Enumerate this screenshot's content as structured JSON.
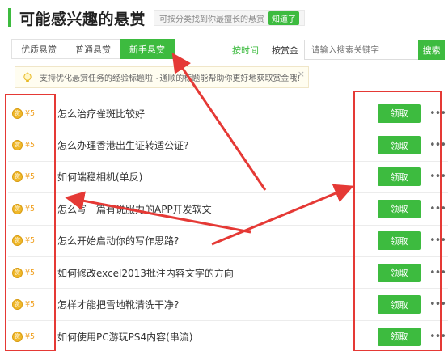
{
  "header": {
    "title": "可能感兴趣的悬赏",
    "tip": "可按分类找到你最擅长的悬赏",
    "tip_button": "知道了"
  },
  "tabs": [
    {
      "label": "优质悬赏",
      "active": false
    },
    {
      "label": "普通悬赏",
      "active": false
    },
    {
      "label": "新手悬赏",
      "active": true
    }
  ],
  "sort": {
    "by_time": "按时间",
    "by_reward": "按赏金"
  },
  "search": {
    "placeholder": "请输入搜索关键字",
    "button": "搜索"
  },
  "notice": {
    "text": "支持优化悬赏任务的经验标题啦~通顺的标题能帮助你更好地获取赏金哦!",
    "close": "×"
  },
  "items": [
    {
      "coin": "赏",
      "amount": "¥5",
      "question": "怎么治疗雀斑比较好",
      "action": "领取",
      "more": "•••"
    },
    {
      "coin": "赏",
      "amount": "¥5",
      "question": "怎么办理香港出生证转适公证?",
      "action": "领取",
      "more": "•••"
    },
    {
      "coin": "赏",
      "amount": "¥5",
      "question": "如何端稳相机(单反)",
      "action": "领取",
      "more": "•••"
    },
    {
      "coin": "赏",
      "amount": "¥5",
      "question": "怎么写一篇有说服力的APP开发软文",
      "action": "领取",
      "more": "•••"
    },
    {
      "coin": "赏",
      "amount": "¥5",
      "question": "怎么开始启动你的写作思路?",
      "action": "领取",
      "more": "•••"
    },
    {
      "coin": "赏",
      "amount": "¥5",
      "question": "如何修改excel2013批注内容文字的方向",
      "action": "领取",
      "more": "•••"
    },
    {
      "coin": "赏",
      "amount": "¥5",
      "question": "怎样才能把雪地靴清洗干净?",
      "action": "领取",
      "more": "•••"
    },
    {
      "coin": "赏",
      "amount": "¥5",
      "question": "如何使用PC游玩PS4内容(串流)",
      "action": "领取",
      "more": "•••"
    }
  ],
  "colors": {
    "accent": "#3dbb3f",
    "annotation": "#e53935",
    "coin": "#f0b829"
  }
}
